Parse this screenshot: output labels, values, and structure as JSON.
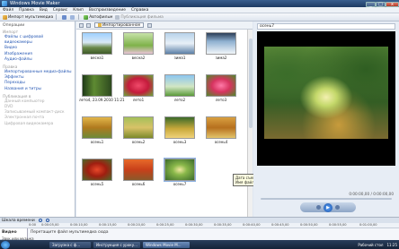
{
  "window": {
    "title": "Windows Movie Maker",
    "min": "_",
    "max": "□",
    "close": "x"
  },
  "menu": [
    "Файл",
    "Правка",
    "Вид",
    "Сервис",
    "Клип",
    "Воспроизведение",
    "Справка"
  ],
  "toolbar": {
    "import_label": "Импорт мультимедиа",
    "autofilm_label": "Автофильм",
    "publish_label": "Публикация фильма"
  },
  "tasks": {
    "header": "Операции",
    "groups": [
      {
        "title": "Импорт",
        "links": [
          "Файлы с цифровой видеокамеры",
          "Видео",
          "Изображения",
          "Аудио-файлы"
        ],
        "disabled": false
      },
      {
        "title": "Правка",
        "links": [
          "Импортированные медиа-файлы",
          "Эффекты",
          "Переходы",
          "Названия и титры"
        ],
        "disabled": false
      },
      {
        "title": "Публикация в",
        "links": [
          "Данный компьютер",
          "DVD",
          "Записываемый компакт-диск",
          "Электронная почта",
          "Цифровая видеокамера"
        ],
        "disabled": true
      }
    ]
  },
  "collection_toolbar": {
    "dropdown_label": "Импортированное"
  },
  "clips": [
    {
      "caption": "весна1"
    },
    {
      "caption": "весна2"
    },
    {
      "caption": "зима1"
    },
    {
      "caption": "зима2"
    },
    {
      "caption": "лето4, 23.09.2010 11:21"
    },
    {
      "caption": "лето1"
    },
    {
      "caption": "лето2"
    },
    {
      "caption": "лето3"
    },
    {
      "caption": "осень1"
    },
    {
      "caption": "осень2"
    },
    {
      "caption": "осень3"
    },
    {
      "caption": "осень4"
    },
    {
      "caption": "осень5"
    },
    {
      "caption": "осень6"
    },
    {
      "caption": "осень7"
    }
  ],
  "tooltip": {
    "line1": "Дата съемки:",
    "line2": "Имя файла: осень4.jpg"
  },
  "monitor": {
    "title": "осень7",
    "time": "0:00:00,00 / 0:00:00,00"
  },
  "timeline": {
    "label": "Шкала времени",
    "ticks": [
      "0:00",
      "0:00:05,00",
      "0:00:10,00",
      "0:00:15,00",
      "0:00:20,00",
      "0:00:25,00",
      "0:00:30,00",
      "0:00:35,00",
      "0:00:40,00",
      "0:00:45,00",
      "0:00:50,00",
      "0:00:55,00",
      "0:01:00,00"
    ],
    "track_name": "Видео",
    "track_hint": "Перетащите файл мультимедиа сюда",
    "track_sub": "Звук или музыка"
  },
  "taskbar": {
    "items": [
      "Загрузка с ф...",
      "Инструкция с уроку...",
      "Windows Movie M..."
    ],
    "active_index": 2,
    "tray_label": "Рабочий стол",
    "clock": "11:25"
  }
}
